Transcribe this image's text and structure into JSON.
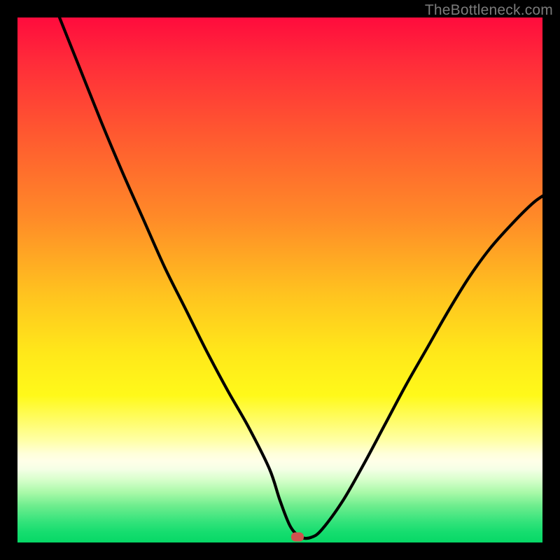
{
  "watermark": "TheBottleneck.com",
  "marker": {
    "x_pct": 53.3,
    "y_pct": 98.9
  },
  "chart_data": {
    "type": "line",
    "title": "",
    "xlabel": "",
    "ylabel": "",
    "xlim": [
      0,
      100
    ],
    "ylim": [
      0,
      100
    ],
    "grid": false,
    "series": [
      {
        "name": "bottleneck-curve",
        "x": [
          8.0,
          12,
          16,
          20,
          24,
          28,
          32,
          36,
          40,
          44,
          48,
          50,
          52,
          54,
          56,
          58,
          62,
          66,
          70,
          74,
          78,
          82,
          86,
          90,
          94,
          98,
          100
        ],
        "y": [
          100,
          90,
          80,
          70.5,
          61.5,
          52.5,
          44.5,
          36.5,
          29,
          22,
          14,
          8,
          3,
          1,
          1,
          2.5,
          8,
          15,
          22.5,
          30,
          37,
          44,
          50.5,
          56,
          60.5,
          64.5,
          66
        ]
      }
    ],
    "legend": false
  }
}
